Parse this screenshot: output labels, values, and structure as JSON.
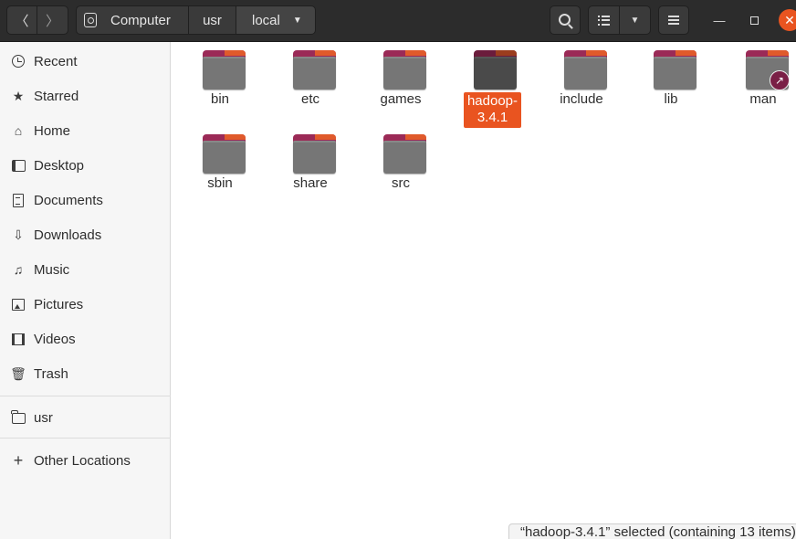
{
  "header": {
    "back_icon": "chevron-left-icon",
    "forward_icon": "chevron-right-icon",
    "breadcrumbs": [
      {
        "label": "Computer",
        "icon": "disk-icon"
      },
      {
        "label": "usr"
      },
      {
        "label": "local",
        "icon": "dropdown-arrow-icon"
      }
    ],
    "window_controls": [
      "minimize",
      "maximize",
      "close"
    ]
  },
  "sidebar": {
    "items": [
      {
        "label": "Recent",
        "icon": "clock-icon"
      },
      {
        "label": "Starred",
        "icon": "star-icon"
      },
      {
        "label": "Home",
        "icon": "home-icon"
      },
      {
        "label": "Desktop",
        "icon": "desktop-icon"
      },
      {
        "label": "Documents",
        "icon": "document-icon"
      },
      {
        "label": "Downloads",
        "icon": "download-icon"
      },
      {
        "label": "Music",
        "icon": "music-icon"
      },
      {
        "label": "Pictures",
        "icon": "picture-icon"
      },
      {
        "label": "Videos",
        "icon": "video-icon"
      },
      {
        "label": "Trash",
        "icon": "trash-icon"
      }
    ],
    "bookmarks": [
      {
        "label": "usr",
        "icon": "folder-icon"
      }
    ],
    "other_locations": {
      "label": "Other Locations",
      "icon": "plus-icon"
    }
  },
  "files": [
    {
      "name": "bin"
    },
    {
      "name": "etc"
    },
    {
      "name": "games"
    },
    {
      "name": "hadoop-3.4.1",
      "label_line1": "hadoop-",
      "label_line2": "3.4.1",
      "selected": true
    },
    {
      "name": "include"
    },
    {
      "name": "lib"
    },
    {
      "name": "man",
      "symlink": true
    },
    {
      "name": "sbin"
    },
    {
      "name": "share"
    },
    {
      "name": "src"
    }
  ],
  "status": {
    "text": "“hadoop-3.4.1” selected  (containing 13 items)"
  },
  "colors": {
    "accent": "#e95420",
    "header_bg": "#2c2c2c",
    "folder_tab": "#9b2a57",
    "folder_body": "#767676"
  }
}
